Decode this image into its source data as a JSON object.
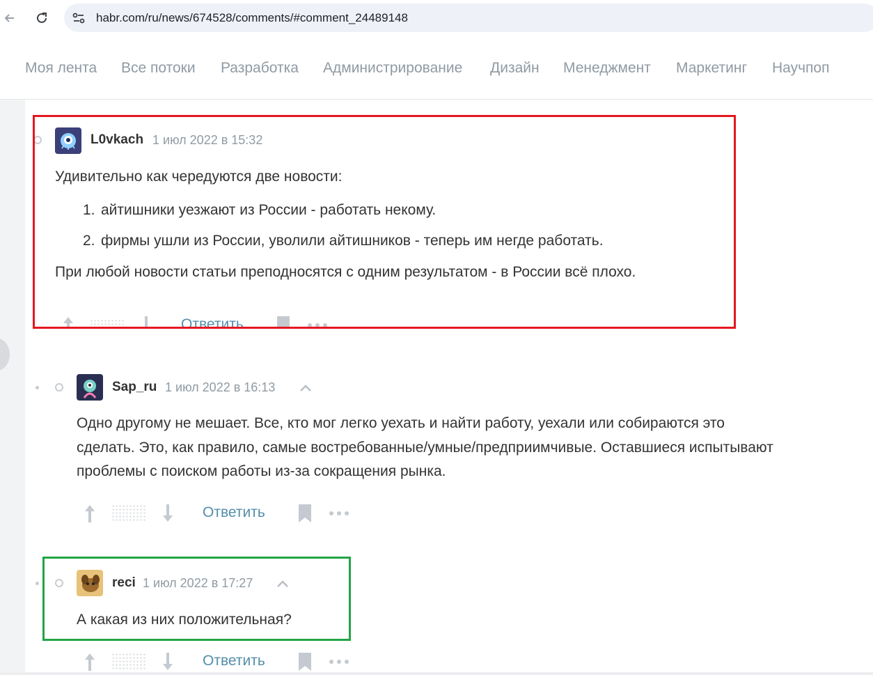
{
  "browser": {
    "url": "habr.com/ru/news/674528/comments/#comment_24489148"
  },
  "hubs": [
    "Моя лента",
    "Все потоки",
    "Разработка",
    "Администрирование",
    "Дизайн",
    "Менеджмент",
    "Маркетинг",
    "Научпоп"
  ],
  "comments": [
    {
      "author": "L0vkach",
      "date": "1 июл 2022 в 15:32",
      "intro": "Удивительно как чередуются две новости:",
      "list": [
        {
          "num": "1.",
          "text": "айтишники уезжают из России - работать некому."
        },
        {
          "num": "2.",
          "text": "фирмы ушли из России, уволили айтишников - теперь им негде работать."
        }
      ],
      "outro": "При любой новости статьи преподносятся с одним результатом - в России всё плохо.",
      "reply_label": "Ответить"
    },
    {
      "author": "Sap_ru",
      "date": "1 июл 2022 в 16:13",
      "lines": [
        "Одно другому не мешает. Все, кто мог легко уехать и найти работу, уехали или собираются это",
        "сделать. Это, как правило, самые востребованные/умные/предприимчивые. Оставшиеся испытывают",
        "проблемы с поиском работы из-за сокращения рынка."
      ],
      "reply_label": "Ответить"
    },
    {
      "author": "reci",
      "date": "1 июл 2022 в 17:27",
      "text": "А какая из них положительная?",
      "reply_label": "Ответить"
    }
  ],
  "colors": {
    "highlight_red": "#e3181f",
    "highlight_green": "#22a445",
    "reply_link": "#548eaa",
    "muted_text": "#909aa3"
  }
}
